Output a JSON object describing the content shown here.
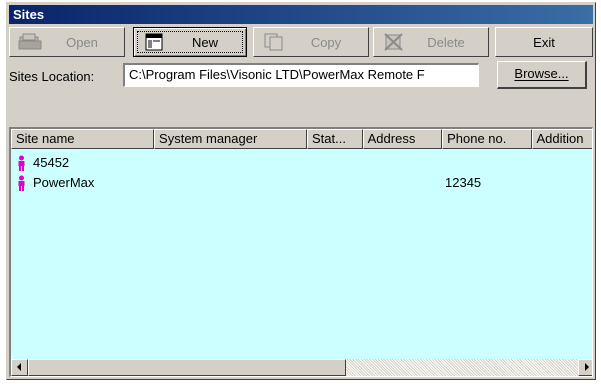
{
  "window": {
    "title": "Sites"
  },
  "toolbar": {
    "open_label": "Open",
    "new_label": "New",
    "copy_label": "Copy",
    "delete_label": "Delete",
    "exit_label": "Exit"
  },
  "location": {
    "label": "Sites Location:",
    "value": "C:\\Program Files\\Visonic LTD\\PowerMax Remote F",
    "browse_label": "Browse..."
  },
  "list": {
    "columns": [
      "Site name",
      "System manager",
      "Stat...",
      "Address",
      "Phone no.",
      "Addition"
    ],
    "rows": [
      {
        "site_name": "45452",
        "phone": ""
      },
      {
        "site_name": "PowerMax",
        "phone": "12345"
      }
    ]
  },
  "colors": {
    "list_bg": "#ccffff",
    "title_bar": "#0a246a",
    "site_icon": "#e000c8"
  },
  "icons": {
    "open": "folder-open-icon",
    "new": "new-document-icon",
    "copy": "copy-icon",
    "delete": "delete-icon",
    "site": "person-icon"
  }
}
